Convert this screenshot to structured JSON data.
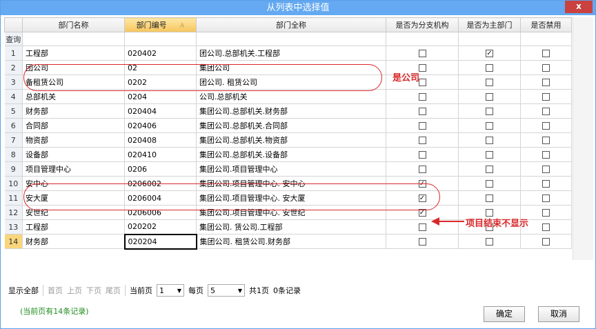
{
  "window": {
    "title": "从列表中选择值",
    "close_label": "x"
  },
  "grid": {
    "columns": [
      "部门名称",
      "部门编号",
      "部门全称",
      "是否为分支机构",
      "是否为主部门",
      "是否禁用"
    ],
    "sort_indicator": "A",
    "query_label": "查询",
    "rows": [
      {
        "num": "1",
        "name": "工程部",
        "code": "020402",
        "full": "团公司.总部机关.工程部",
        "branch": false,
        "main": true,
        "disabled": false
      },
      {
        "num": "2",
        "name": "团公司",
        "code": "02",
        "full": "集团公司",
        "branch": false,
        "main": false,
        "disabled": false
      },
      {
        "num": "3",
        "name": "备租赁公司",
        "code": "0202",
        "full": "团公司.  租赁公司",
        "branch": false,
        "main": false,
        "disabled": false
      },
      {
        "num": "4",
        "name": "总部机关",
        "code": "0204",
        "full": "公司.总部机关",
        "branch": false,
        "main": false,
        "disabled": false
      },
      {
        "num": "5",
        "name": "财务部",
        "code": "020404",
        "full": "集团公司.总部机关.财务部",
        "branch": false,
        "main": false,
        "disabled": false
      },
      {
        "num": "6",
        "name": "合同部",
        "code": "020406",
        "full": "集团公司.总部机关.合同部",
        "branch": false,
        "main": false,
        "disabled": false
      },
      {
        "num": "7",
        "name": "物资部",
        "code": "020408",
        "full": "集团公司.总部机关.物资部",
        "branch": false,
        "main": false,
        "disabled": false
      },
      {
        "num": "8",
        "name": "设备部",
        "code": "020410",
        "full": "集团公司.总部机关.设备部",
        "branch": false,
        "main": false,
        "disabled": false
      },
      {
        "num": "9",
        "name": "项目管理中心",
        "code": "0206",
        "full": "集团公司.项目管理中心",
        "branch": false,
        "main": false,
        "disabled": false
      },
      {
        "num": "10",
        "name": "安中心",
        "code": "0206002",
        "full": "集团公司.项目管理中心.  安中心",
        "branch": true,
        "main": false,
        "disabled": false
      },
      {
        "num": "11",
        "name": "安大厦",
        "code": "0206004",
        "full": "集团公司.项目管理中心.  安大厦",
        "branch": true,
        "main": false,
        "disabled": false
      },
      {
        "num": "12",
        "name": "安世纪",
        "code": "0206006",
        "full": "集团公司.项目管理中心.  安世纪",
        "branch": true,
        "main": false,
        "disabled": false
      },
      {
        "num": "13",
        "name": "工程部",
        "code": "020202",
        "full": "集团公司.  赁公司.工程部",
        "branch": false,
        "main": false,
        "disabled": false
      },
      {
        "num": "14",
        "name": "财务部",
        "code": "020204",
        "full": "集团公司.  租赁公司.财务部",
        "branch": false,
        "main": false,
        "disabled": false
      }
    ],
    "selected_row": "14"
  },
  "annotations": {
    "company_label": "是公司",
    "hidden_label": "项目结束不显示",
    "color": "#d9282b"
  },
  "pager": {
    "show_all": "显示全部",
    "first": "首页",
    "prev": "上页",
    "next": "下页",
    "last": "尾页",
    "current_label": "当前页",
    "current_value": "1",
    "per_page_label": "每页",
    "per_page_value": "5",
    "total_pages": "共1页",
    "record_count": "0条记录",
    "page_info": "(当前页有14条记录)"
  },
  "buttons": {
    "ok": "确定",
    "cancel": "取消"
  }
}
